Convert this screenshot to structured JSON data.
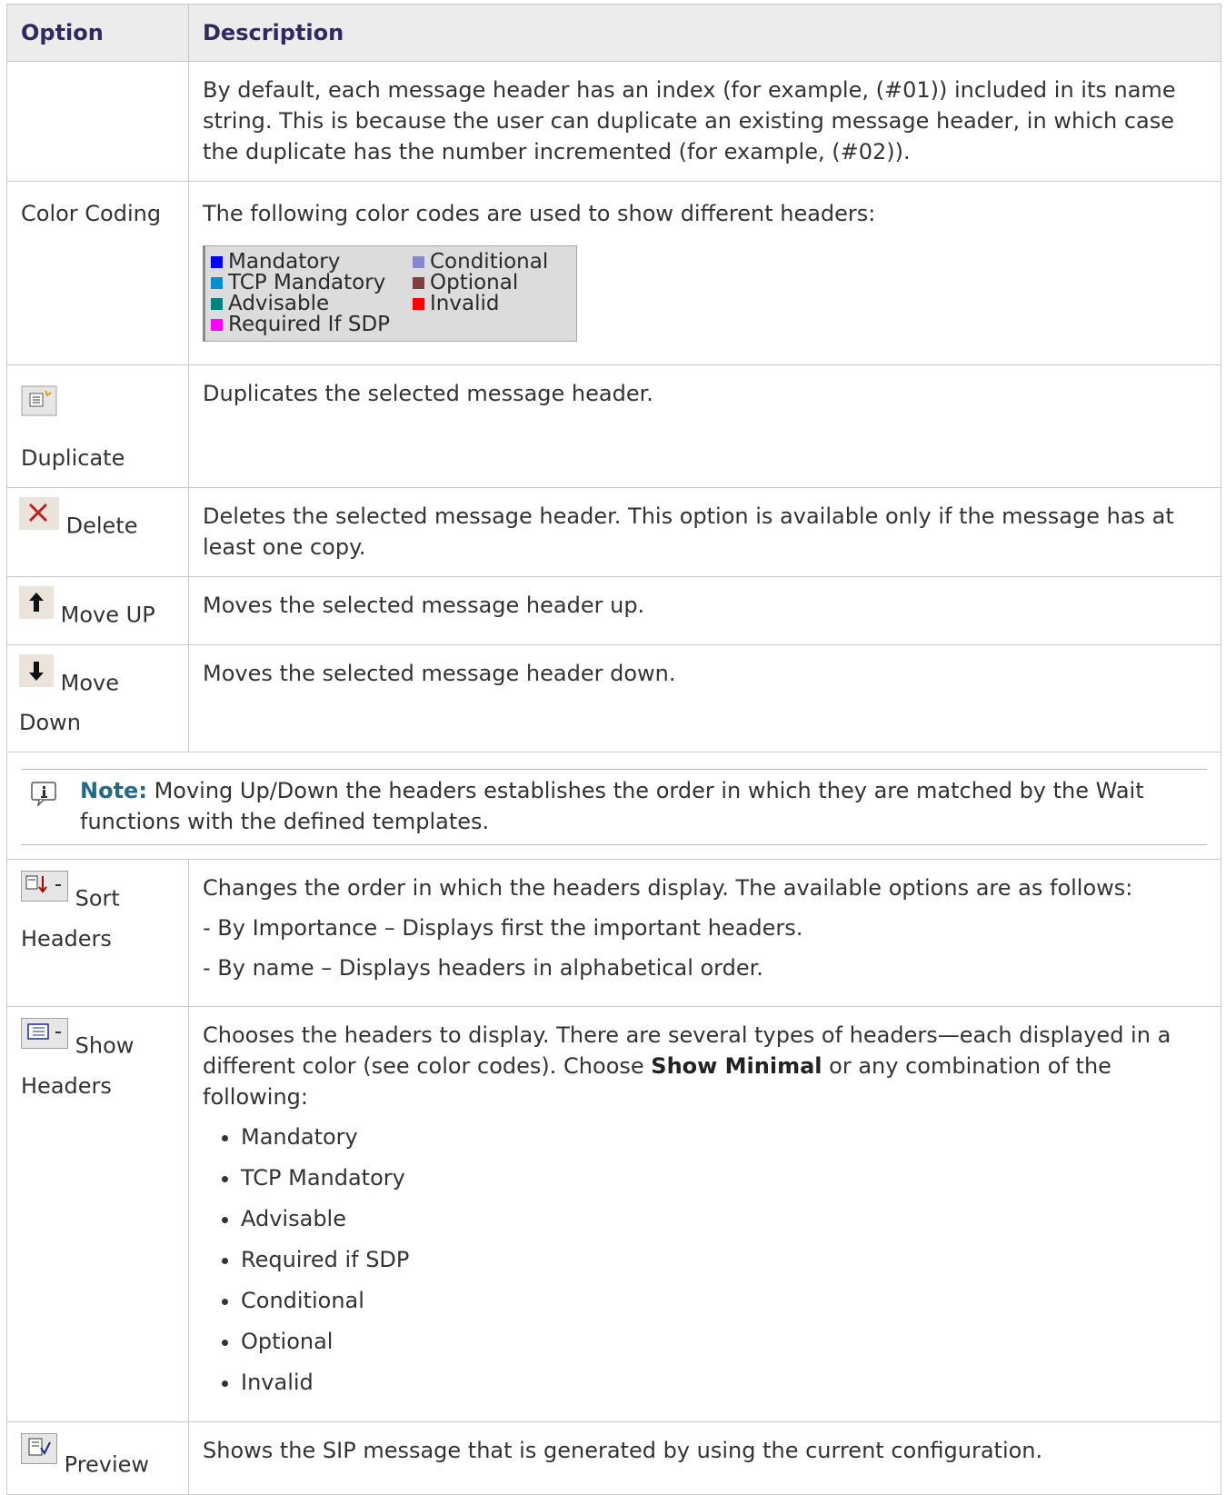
{
  "header": {
    "option": "Option",
    "description": "Description"
  },
  "intro": {
    "description": "By default, each message header has an index (for example, (#01)) included in its name string. This is because the user can duplicate an existing message header, in which case the duplicate has the number incremented (for example, (#02))."
  },
  "color_coding": {
    "option": "Color Coding",
    "description": "The following color codes are used to show different headers:",
    "legend": [
      {
        "label": "Mandatory",
        "color": "#0000ff"
      },
      {
        "label": "TCP Mandatory",
        "color": "#0090d0"
      },
      {
        "label": "Advisable",
        "color": "#008080"
      },
      {
        "label": "Required If SDP",
        "color": "#ff00ff"
      },
      {
        "label": "Conditional",
        "color": "#8888cc"
      },
      {
        "label": "Optional",
        "color": "#804040"
      },
      {
        "label": "Invalid",
        "color": "#ff0000"
      }
    ]
  },
  "duplicate": {
    "option": "Duplicate",
    "icon": "duplicate-icon",
    "description": "Duplicates the selected message header."
  },
  "delete": {
    "option": "Delete",
    "icon": "delete-x-icon",
    "description": "Deletes the selected message header. This option is available only if the message has at least one copy."
  },
  "move_up": {
    "option": "Move UP",
    "icon": "arrow-up-icon",
    "description": "Moves the selected message header up."
  },
  "move_down": {
    "option": "Move Down",
    "icon": "arrow-down-icon",
    "description": "Moves the selected message header down."
  },
  "note": {
    "label": "Note:",
    "text": "Moving Up/Down the headers establishes the order in which they are matched by the Wait functions with the defined templates."
  },
  "sort_headers": {
    "option": "Sort Headers",
    "icon": "sort-icon",
    "description": "Changes the order in which the headers display. The available options are as follows:",
    "options": [
      "- By Importance – Displays first the important headers.",
      "- By name – Displays headers in alphabetical order."
    ]
  },
  "show_headers": {
    "option": "Show Headers",
    "icon": "show-headers-icon",
    "description_pre": "Chooses the headers to display. There are several types of headers—each displayed in a different color (see color codes). Choose ",
    "description_bold": "Show Minimal",
    "description_post": " or any combination of the following:",
    "items": [
      "Mandatory",
      "TCP Mandatory",
      "Advisable",
      "Required if SDP",
      "Conditional",
      "Optional",
      "Invalid"
    ]
  },
  "preview": {
    "option": "Preview",
    "icon": "preview-icon",
    "description": "Shows the SIP message that is generated by using the current configuration."
  }
}
